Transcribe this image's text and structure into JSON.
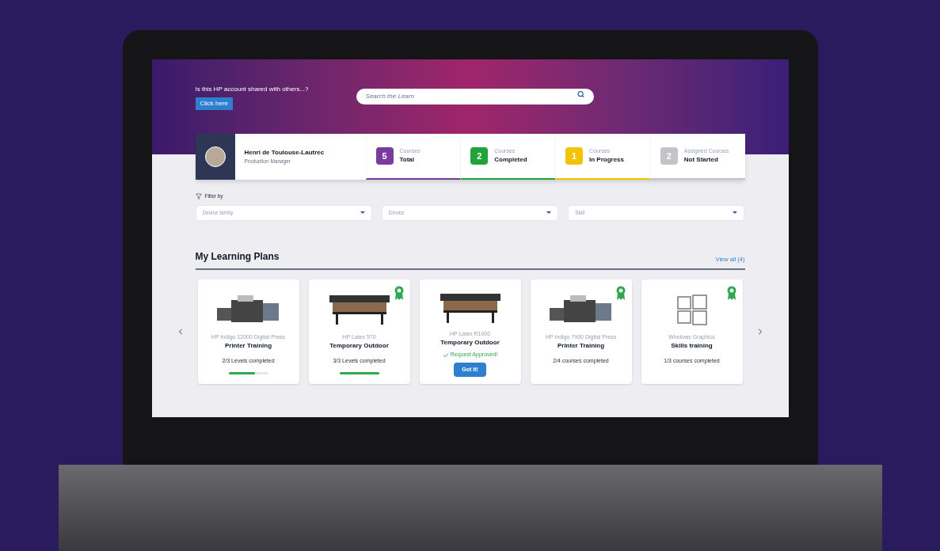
{
  "banner": {
    "question": "Is this HP account shared with others...?",
    "button": "Click here"
  },
  "search": {
    "placeholder": "Search the Learn"
  },
  "profile": {
    "name": "Henri de Toulouse-Lautrec",
    "role": "Production Manager"
  },
  "stats": [
    {
      "count": "5",
      "caption": "Courses",
      "label": "Total",
      "color": "#7b3a9e"
    },
    {
      "count": "2",
      "caption": "Courses",
      "label": "Completed",
      "color": "#22a33a"
    },
    {
      "count": "1",
      "caption": "Courses",
      "label": "In Progress",
      "color": "#f3c200"
    },
    {
      "count": "2",
      "caption": "Assigned Courses",
      "label": "Not Started",
      "color": "#c4c4c8"
    }
  ],
  "filter": {
    "title": "Filter by",
    "fields": [
      {
        "placeholder": "Device family"
      },
      {
        "placeholder": "Device"
      },
      {
        "placeholder": "Skill"
      }
    ]
  },
  "plans": {
    "title": "My Learning Plans",
    "view_all": "View all (4)",
    "cards": [
      {
        "kind": "progress",
        "device": "HP Indigo 12000 Digital Press",
        "title": "Printer Training",
        "status": "2/3 Levels completed",
        "level": 0.667,
        "awarded": false,
        "image": {
          "kind": "press"
        }
      },
      {
        "kind": "progress",
        "device": "HP Latex 570",
        "title": "Temporary Outdoor",
        "status": "3/3 Levels completed",
        "level": 1,
        "awarded": true,
        "image": {
          "kind": "latex"
        }
      },
      {
        "kind": "approved",
        "device": "HP Latex R1000",
        "title": "Temporary Outdoor",
        "status": "Request Approved!",
        "button": "Got It!",
        "awarded": false,
        "image": {
          "kind": "latex"
        }
      },
      {
        "kind": "text",
        "device": "HP Indigo 7900 Digital Press",
        "title": "Printer Training",
        "status": "2/4 courses completed",
        "awarded": true,
        "image": {
          "kind": "press"
        }
      },
      {
        "kind": "text",
        "device": "Windows Graphics",
        "title": "Skills training",
        "status": "1/3 courses completed",
        "awarded": true,
        "image": {
          "kind": "windows"
        }
      }
    ]
  }
}
